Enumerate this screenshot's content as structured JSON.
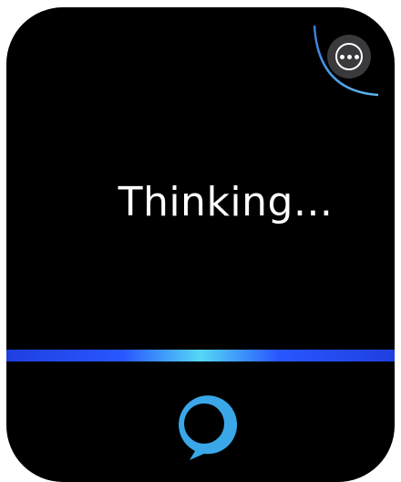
{
  "status": {
    "text": "Thinking..."
  },
  "more_button": {
    "icon": "more-options-icon"
  },
  "light_bar": {
    "colors": [
      "#1f3fe0",
      "#2856ff",
      "#55d8f5"
    ]
  },
  "assistant_icon": {
    "icon": "alexa-ring-icon",
    "color": "#3aa8e8"
  }
}
